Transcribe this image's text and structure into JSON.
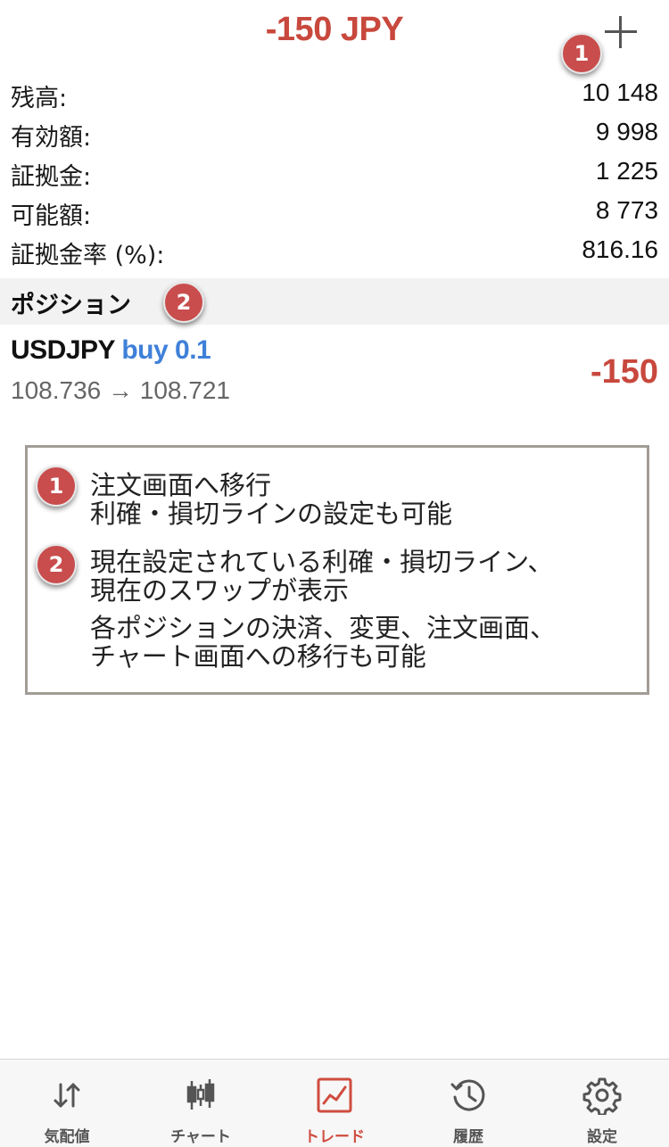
{
  "header": {
    "title": "-150 JPY",
    "title_color": "#c8483d",
    "add_icon": "plus-icon"
  },
  "callouts": [
    "1",
    "2"
  ],
  "account": {
    "rows": [
      {
        "label": "残高:",
        "value": "10 148"
      },
      {
        "label": "有効額:",
        "value": "9 998"
      },
      {
        "label": "証拠金:",
        "value": "1 225"
      },
      {
        "label": "可能額:",
        "value": "8 773"
      },
      {
        "label": "証拠金率 (%):",
        "value": "816.16"
      }
    ]
  },
  "positions_section": {
    "title": "ポジション"
  },
  "position": {
    "symbol": "USDJPY",
    "side": "buy 0.1",
    "prices": "108.736 → 108.721",
    "profit": "-150",
    "side_color": "#3f80d9",
    "profit_color": "#c8483d"
  },
  "notes": {
    "n1_line1": "注文画面へ移行",
    "n1_line2": "利確・損切ラインの設定も可能",
    "n2_line1": "現在設定されている利確・損切ライン、",
    "n2_line2": "現在のスワップが表示",
    "n3_line1": "各ポジションの決済、変更、注文画面、",
    "n3_line2": "チャート画面への移行も可能"
  },
  "tabbar": {
    "active_color": "#cf4c3f",
    "tabs": [
      {
        "label": "気配値",
        "icon": "quotes-arrows-icon"
      },
      {
        "label": "チャート",
        "icon": "candlestick-chart-icon"
      },
      {
        "label": "トレード",
        "icon": "trade-chart-icon",
        "active": true
      },
      {
        "label": "履歴",
        "icon": "history-clock-icon"
      },
      {
        "label": "設定",
        "icon": "gear-icon"
      }
    ]
  }
}
